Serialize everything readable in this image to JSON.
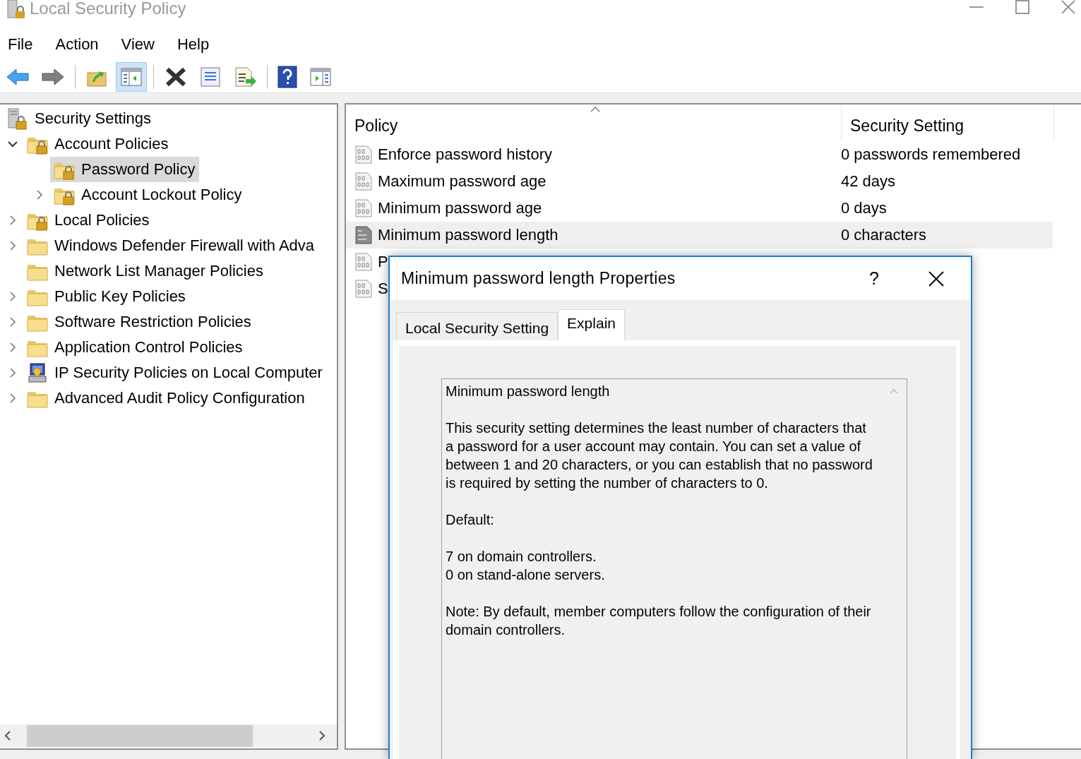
{
  "window": {
    "title": "Local Security Policy"
  },
  "menu": [
    {
      "label": "File"
    },
    {
      "label": "Action"
    },
    {
      "label": "View"
    },
    {
      "label": "Help"
    }
  ],
  "toolbar": [
    {
      "kind": "back",
      "pressed": false
    },
    {
      "kind": "forward",
      "pressed": false
    },
    {
      "kind": "sep"
    },
    {
      "kind": "up",
      "pressed": false
    },
    {
      "kind": "tree",
      "pressed": true
    },
    {
      "kind": "sep"
    },
    {
      "kind": "delete",
      "pressed": false
    },
    {
      "kind": "properties",
      "pressed": false
    },
    {
      "kind": "export",
      "pressed": false
    },
    {
      "kind": "sep"
    },
    {
      "kind": "help",
      "pressed": false
    },
    {
      "kind": "action",
      "pressed": false
    }
  ],
  "tree": [
    {
      "label": "Security Settings",
      "kind": "root",
      "selected": false,
      "children": [
        {
          "label": "Account Policies",
          "kind": "lock-folder",
          "expanded": true,
          "selected": false,
          "children": [
            {
              "label": "Password Policy",
              "kind": "lock-folder",
              "selected": true
            },
            {
              "label": "Account Lockout Policy",
              "kind": "lock-folder",
              "expanded": false,
              "selected": false
            }
          ]
        },
        {
          "label": "Local Policies",
          "kind": "lock-folder",
          "expanded": false,
          "selected": false
        },
        {
          "label": "Windows Defender Firewall with Adva",
          "kind": "folder",
          "expanded": false,
          "selected": false
        },
        {
          "label": "Network List Manager Policies",
          "kind": "folder",
          "selected": false
        },
        {
          "label": "Public Key Policies",
          "kind": "folder",
          "expanded": false,
          "selected": false
        },
        {
          "label": "Software Restriction Policies",
          "kind": "folder",
          "expanded": false,
          "selected": false
        },
        {
          "label": "Application Control Policies",
          "kind": "folder",
          "expanded": false,
          "selected": false
        },
        {
          "label": "IP Security Policies on Local Computer",
          "kind": "ip",
          "expanded": false,
          "selected": false
        },
        {
          "label": "Advanced Audit Policy Configuration",
          "kind": "folder",
          "expanded": false,
          "selected": false
        }
      ]
    }
  ],
  "table": {
    "columns": [
      "Policy",
      "Security Setting"
    ],
    "rows": [
      {
        "policy": "Enforce password history",
        "setting": "0 passwords remembered",
        "selected": false
      },
      {
        "policy": "Maximum password age",
        "setting": "42 days",
        "selected": false
      },
      {
        "policy": "Minimum password age",
        "setting": "0 days",
        "selected": false
      },
      {
        "policy": "Minimum password length",
        "setting": "0 characters",
        "selected": true
      },
      {
        "policy": "P",
        "selected": false
      },
      {
        "policy": "S",
        "selected": false
      }
    ]
  },
  "dialog": {
    "title": "Minimum password length Properties",
    "help": "?",
    "tabs": [
      {
        "label": "Local Security Setting",
        "selected": false
      },
      {
        "label": "Explain",
        "selected": true
      }
    ],
    "explain": [
      "Minimum password length",
      "This security setting determines the least number of characters that a password for a user account may contain. You can set a value of between 1 and 20 characters, or you can establish that no password is required by setting the number of characters to 0.",
      "Default:",
      "7 on domain controllers.\n0 on stand-alone servers.",
      "Note: By default, member computers follow the configuration of their domain controllers."
    ]
  }
}
